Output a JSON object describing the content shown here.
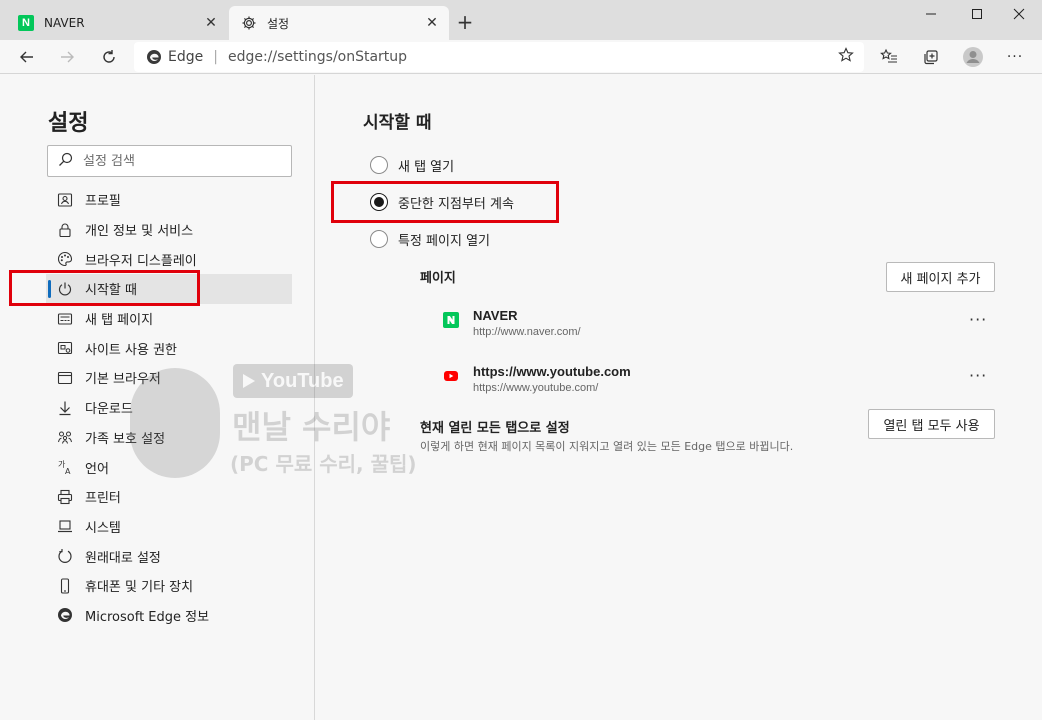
{
  "tabs": [
    {
      "title": "NAVER",
      "favicon": "naver-icon",
      "active": false
    },
    {
      "title": "설정",
      "favicon": "gear-icon",
      "active": true
    }
  ],
  "address_bar": {
    "brand": "Edge",
    "url_host": "edge://",
    "url_path": "settings/onStartup"
  },
  "sidebar": {
    "title": "설정",
    "search_placeholder": "설정 검색",
    "items": [
      {
        "label": "프로필",
        "icon": "profile-icon"
      },
      {
        "label": "개인 정보 및 서비스",
        "icon": "lock-icon"
      },
      {
        "label": "브라우저 디스플레이",
        "icon": "palette-icon"
      },
      {
        "label": "시작할 때",
        "icon": "power-icon",
        "active": true
      },
      {
        "label": "새 탭 페이지",
        "icon": "newtab-icon"
      },
      {
        "label": "사이트 사용 권한",
        "icon": "site-permissions-icon"
      },
      {
        "label": "기본 브라우저",
        "icon": "browser-icon"
      },
      {
        "label": "다운로드",
        "icon": "download-icon"
      },
      {
        "label": "가족 보호 설정",
        "icon": "family-icon"
      },
      {
        "label": "언어",
        "icon": "language-icon"
      },
      {
        "label": "프린터",
        "icon": "printer-icon"
      },
      {
        "label": "시스템",
        "icon": "system-icon"
      },
      {
        "label": "원래대로 설정",
        "icon": "reset-icon"
      },
      {
        "label": "휴대폰 및 기타 장치",
        "icon": "phone-icon"
      },
      {
        "label": "Microsoft Edge 정보",
        "icon": "edge-icon"
      }
    ]
  },
  "main": {
    "title": "시작할 때",
    "options": [
      {
        "label": "새 탭 열기",
        "checked": false
      },
      {
        "label": "중단한 지점부터 계속",
        "checked": true
      },
      {
        "label": "특정 페이지 열기",
        "checked": false
      }
    ],
    "pages_label": "페이지",
    "add_page_button": "새 페이지 추가",
    "sites": [
      {
        "name": "NAVER",
        "url": "http://www.naver.com/",
        "more": "···"
      },
      {
        "name": "https://www.youtube.com",
        "url": "https://www.youtube.com/",
        "more": "···"
      }
    ],
    "set_current_label": "현재 열린 모든 탭으로 설정",
    "set_current_desc": "이렇게 하면 현재 페이지 목록이 지워지고 열려 있는 모든 Edge 탭으로 바뀝니다.",
    "use_all_tabs_button": "열린 탭 모두 사용"
  },
  "watermark": {
    "brand": "YouTube",
    "title": "맨날 수리야",
    "subtitle": "(PC 무료 수리, 꿀팁)"
  },
  "colors": {
    "accent": "#0f6cbd",
    "highlight": "#e0000b",
    "naver": "#03c75a",
    "youtube": "#ff0000"
  }
}
